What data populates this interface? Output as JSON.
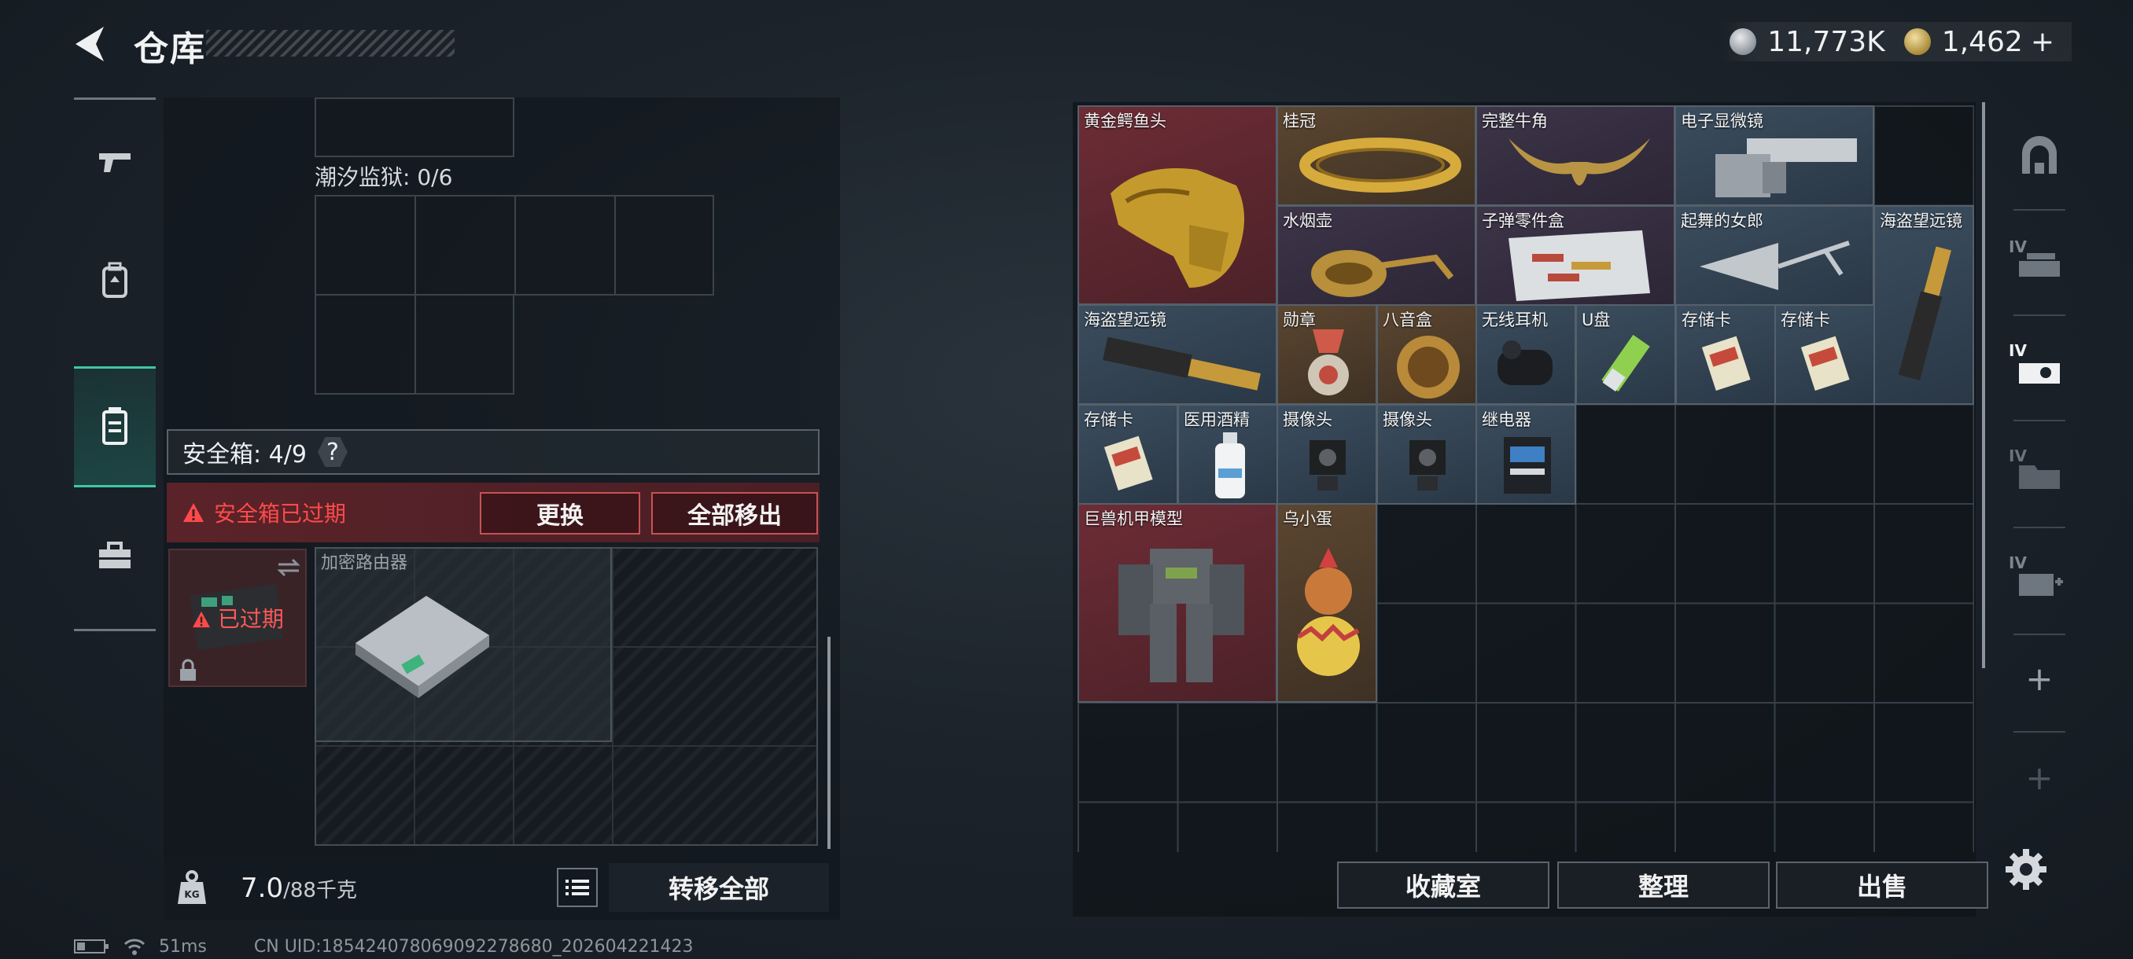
{
  "header": {
    "title": "仓库",
    "currency_silver": "11,773K",
    "currency_gold": "1,462",
    "currency_plus": "+"
  },
  "left_panel": {
    "prison_label": "潮汐监狱: 0/6",
    "safebox_label": "安全箱: 4/9",
    "help_label": "?",
    "expired_warning": "安全箱已过期",
    "replace_button": "更换",
    "move_all_button": "全部移出",
    "thumb_expired": "已过期",
    "router_label": "加密路由器",
    "weight_value": "7.0",
    "weight_capacity": "/88千克",
    "transfer_all_button": "转移全部"
  },
  "status_bar": {
    "ping": "51ms",
    "uid": "CN UID:185424078069092278680_202604221423"
  },
  "inventory": {
    "items": [
      {
        "label": "黄金鳄鱼头"
      },
      {
        "label": "桂冠"
      },
      {
        "label": "完整牛角"
      },
      {
        "label": "电子显微镜"
      },
      {
        "label": "水烟壶"
      },
      {
        "label": "子弹零件盒"
      },
      {
        "label": "起舞的女郎"
      },
      {
        "label": "海盗望远镜"
      },
      {
        "label": "海盗望远镜"
      },
      {
        "label": "勋章"
      },
      {
        "label": "八音盒"
      },
      {
        "label": "无线耳机"
      },
      {
        "label": "U盘"
      },
      {
        "label": "存储卡"
      },
      {
        "label": "存储卡"
      },
      {
        "label": "存储卡"
      },
      {
        "label": "医用酒精"
      },
      {
        "label": "摄像头"
      },
      {
        "label": "摄像头"
      },
      {
        "label": "继电器"
      },
      {
        "label": "巨兽机甲模型"
      },
      {
        "label": "乌小蛋"
      }
    ],
    "collect_button": "收藏室",
    "sort_button": "整理",
    "sell_button": "出售"
  },
  "right_tabs": {
    "tab_labels": [
      "IV",
      "IV",
      "IV",
      "IV",
      "+",
      "+"
    ]
  },
  "colors": {
    "accent_teal": "#3ec7a6",
    "warning_red": "#ff4a4a",
    "rarity_red": "#6d2c35",
    "rarity_gold": "#5b4630",
    "rarity_blue": "#3b4d5e"
  }
}
